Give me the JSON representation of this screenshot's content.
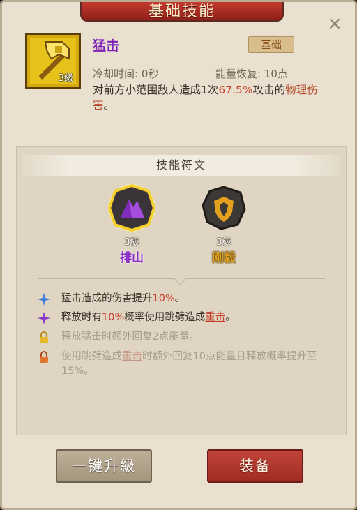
{
  "header": {
    "title": "基础技能"
  },
  "skill": {
    "name": "猛击",
    "level_label": "3級",
    "tag": "基础",
    "cooldown": "冷却时间: 0秒",
    "energy": "能量恢复: 10点",
    "desc_prefix": "对前方小范围敌人造成1次",
    "desc_percent": "67.5%",
    "desc_mid": "攻击的",
    "desc_type": "物理伤害",
    "desc_suffix": "。"
  },
  "runes": {
    "header": "技能符文",
    "items": [
      {
        "level": "3級",
        "name": "排山",
        "color": "#8a2cc4"
      },
      {
        "level": "3級",
        "name": "刚毅",
        "color": "#e0a21c"
      }
    ]
  },
  "effects": [
    {
      "icon": "blue-star-icon",
      "pre": "猛击造成的伤害提升",
      "hl": "10%",
      "post": "。",
      "state": "active"
    },
    {
      "icon": "purple-star-icon",
      "pre": "释放时有",
      "hl": "10%",
      "mid": "概率使用跳劈造成",
      "link": "重击",
      "post": "。",
      "state": "active"
    },
    {
      "icon": "yellow-lock-icon",
      "text": "释放猛击时额外回复2点能量。",
      "state": "locked"
    },
    {
      "icon": "orange-lock-icon",
      "pre": "使用跳劈造成",
      "link": "重击",
      "post": "时额外回复10点能量且释放概率提升至15%。",
      "state": "locked"
    }
  ],
  "buttons": {
    "upgrade": "一键升級",
    "equip": "装备"
  },
  "close_icon": "×"
}
